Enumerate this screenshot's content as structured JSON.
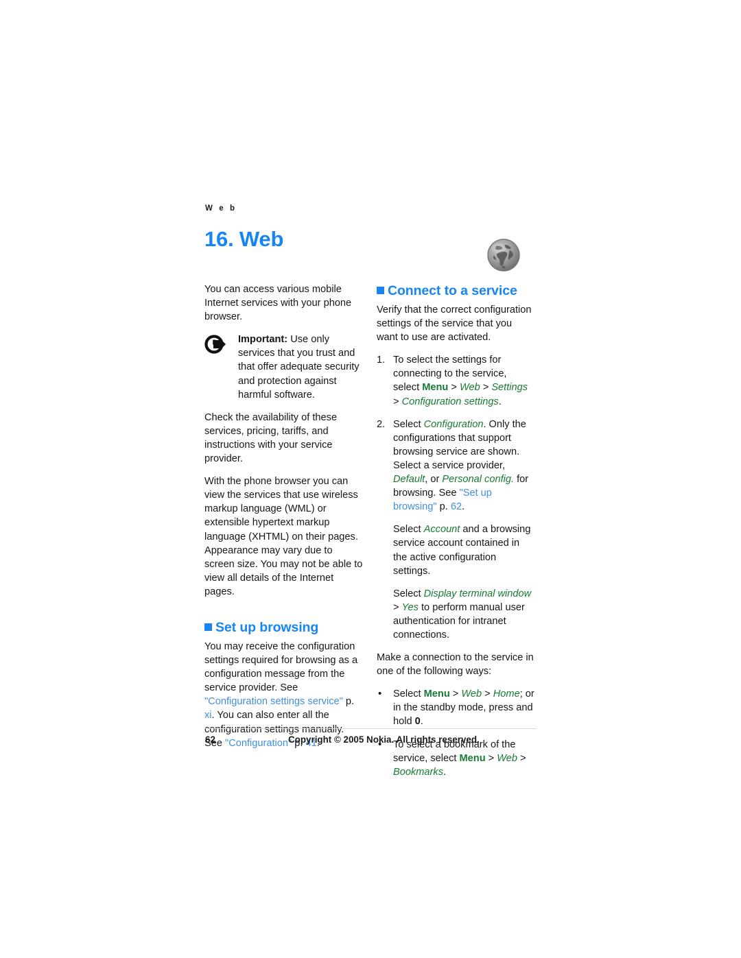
{
  "page": {
    "running_header": "W e b",
    "chapter_title": "16. Web",
    "page_number": "62",
    "copyright": "Copyright © 2005 Nokia. All rights reserved.",
    "icons": {
      "chapter": "globe-icon",
      "note": "important-arrow-icon"
    },
    "colors": {
      "heading_blue": "#1784f5",
      "link_blue": "#3f90e0",
      "menu_green": "#177a33",
      "body_black": "#161616"
    }
  },
  "left_column": {
    "intro": "You can access various mobile Internet services with your phone browser.",
    "note": {
      "label": "Important:",
      "text": " Use only services that you trust and that offer adequate security and protection against harmful software."
    },
    "availability": "Check the availability of these services, pricing, tariffs, and instructions with your service provider.",
    "browser_support": "With the phone browser you can view the services that use wireless markup language (WML) or extensible hypertext markup language (XHTML) on their pages. Appearance may vary due to screen size. You may not be able to view all details of the Internet pages.",
    "setup": {
      "heading": "Set up browsing",
      "para_1": "You may receive the configuration settings required for browsing as a configuration message from the service provider. See ",
      "link_1": "\"Configuration settings service\"",
      "para_2": " p. ",
      "link_2": "xi",
      "para_3": ". You can also enter all the configuration settings manually. See ",
      "link_3": "\"Configuration\"",
      "para_4": " p. ",
      "link_4": "41",
      "para_5": "."
    }
  },
  "right_column": {
    "connect": {
      "heading": "Connect to a service",
      "intro": "Verify that the correct configuration settings of the service that you want to use are activated.",
      "steps": [
        {
          "num": "1.",
          "text_1": "To select the settings for connecting to the service, select ",
          "menu": "Menu",
          "sep_1": " > ",
          "item_1": "Web",
          "sep_2": " > ",
          "item_2": "Settings",
          "sep_3": " > ",
          "item_3": "Configuration settings",
          "text_2": "."
        },
        {
          "num": "2.",
          "text_1": "Select ",
          "item_1": "Configuration",
          "text_2": ". Only the configurations that support browsing service are shown. Select a service provider, ",
          "item_2": "Default",
          "text_3": ", or ",
          "item_3": "Personal config.",
          "text_4": " for browsing. See ",
          "link_1": "\"Set up browsing\"",
          "text_5": " p. ",
          "link_2": "62",
          "text_6": ".",
          "sub_a": {
            "text_1": "Select ",
            "item_1": "Account",
            "text_2": " and a browsing service account contained in the active configuration settings."
          },
          "sub_b": {
            "text_1": "Select ",
            "item_1": "Display terminal window",
            "sep_1": " > ",
            "item_2": "Yes",
            "text_2": " to perform manual user authentication for intranet connections."
          }
        }
      ],
      "ways_intro": "Make a connection to the service in one of the following ways:",
      "bullets": [
        {
          "text_1": "Select ",
          "menu": "Menu",
          "sep_1": " > ",
          "item_1": "Web",
          "sep_2": " > ",
          "item_2": "Home",
          "text_2": "; or in the standby mode, press and hold ",
          "key": "0",
          "text_3": "."
        },
        {
          "text_1": "To select a bookmark of the service, select ",
          "menu": "Menu",
          "sep_1": " > ",
          "item_1": "Web",
          "sep_2": " > ",
          "item_2": "Bookmarks",
          "text_2": "."
        }
      ]
    }
  }
}
